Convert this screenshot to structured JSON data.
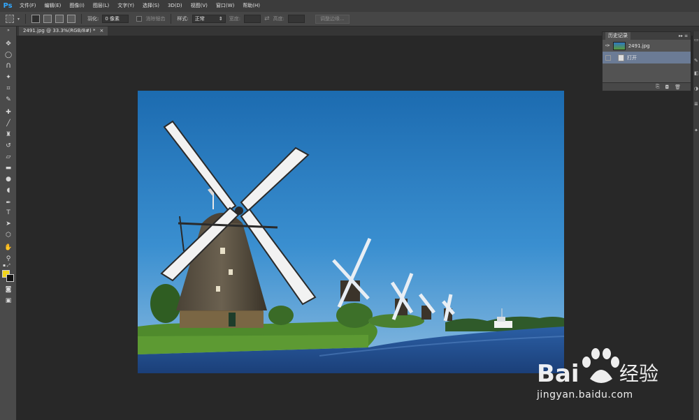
{
  "app": {
    "logo": "Ps",
    "menu": [
      "文件(F)",
      "编辑(E)",
      "图像(I)",
      "图层(L)",
      "文字(Y)",
      "选择(S)",
      "3D(D)",
      "视图(V)",
      "窗口(W)",
      "帮助(H)"
    ]
  },
  "options": {
    "feather_label": "羽化:",
    "feather_value": "0 像素",
    "antialias_label": "消除锯齿",
    "style_label": "样式:",
    "style_value": "正常",
    "width_label": "宽度:",
    "height_label": "高度:",
    "refine_edge_label": "调整边缘..."
  },
  "document": {
    "tab_title": "2491.jpg @ 33.3%(RGB/8#) *",
    "tab_close": "×"
  },
  "tools": {
    "foreground_color": "#f1d51c",
    "background_color": "#111111",
    "type_tool_glyph": "T"
  },
  "history_panel": {
    "title": "历史记录",
    "snapshot_name": "2491.jpg",
    "steps": [
      {
        "label": "打开",
        "active": true
      }
    ]
  },
  "watermark": {
    "brand": "Bai du 经验",
    "url": "jingyan.baidu.com"
  },
  "colors": {
    "accent": "#31a8ff",
    "history_active": "#6b7b95",
    "panel_bg": "#535353",
    "workspace_bg": "#282828"
  }
}
